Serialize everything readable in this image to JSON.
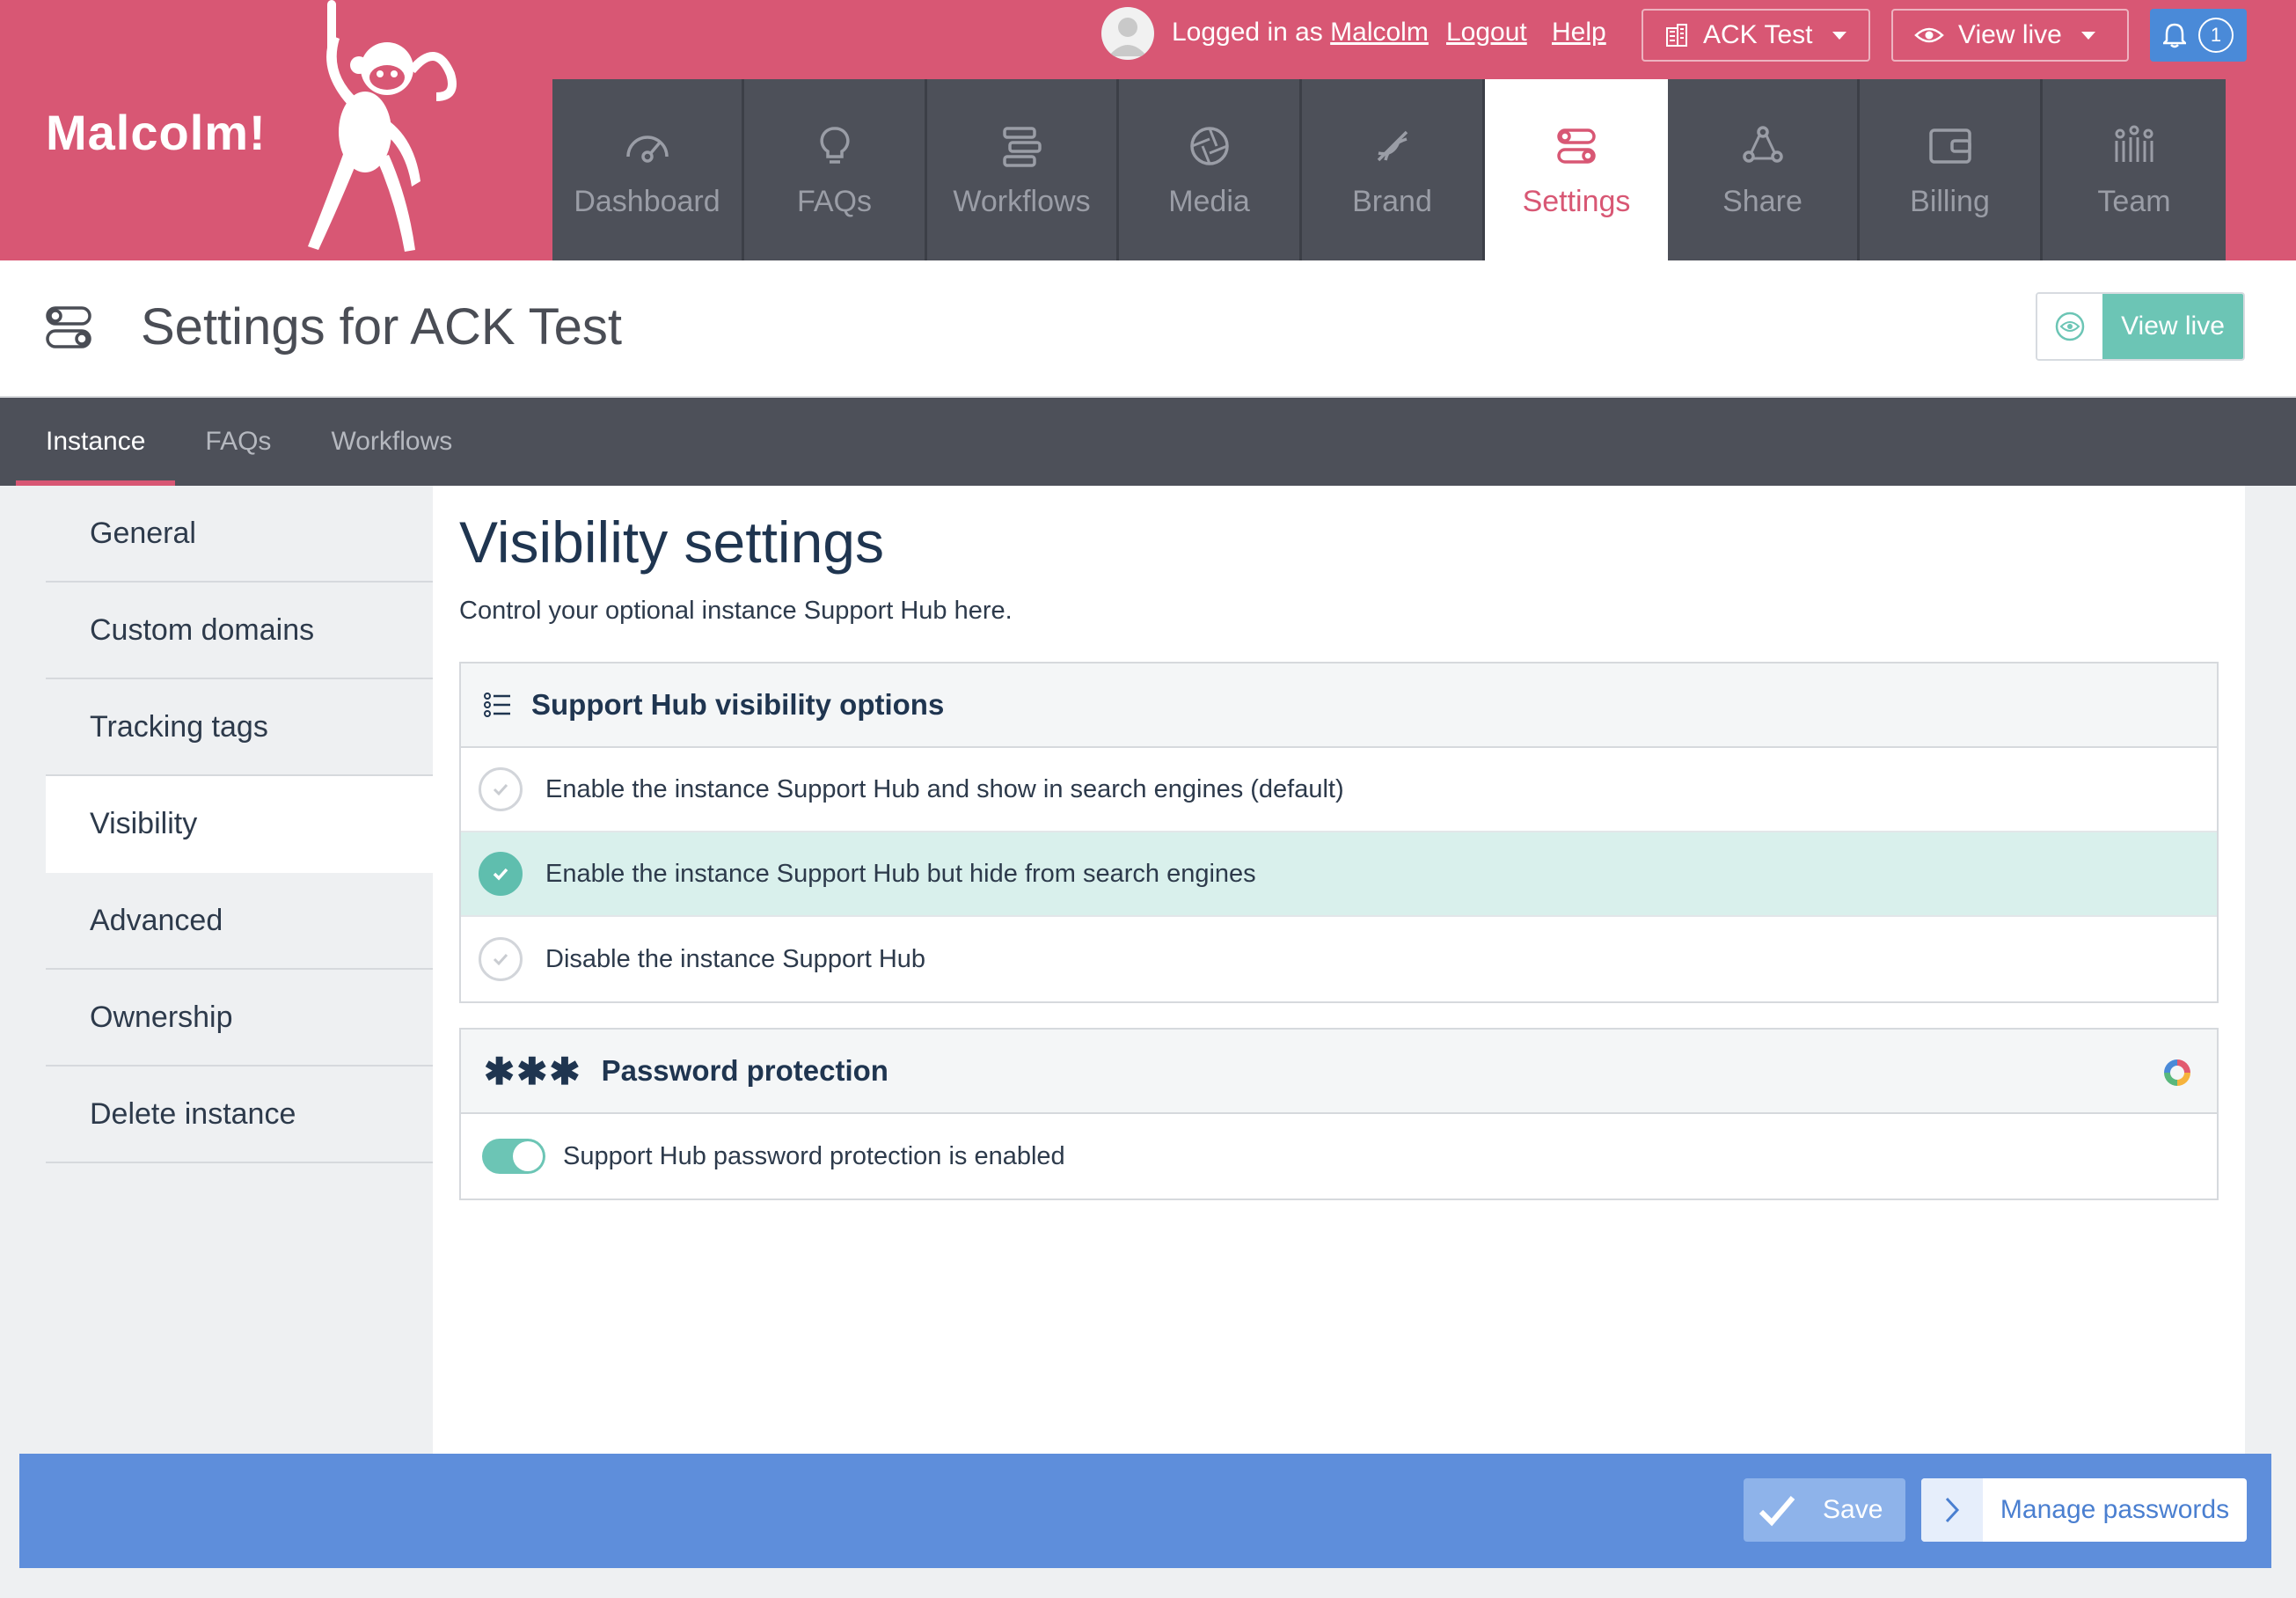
{
  "brand": {
    "name": "Malcolm!"
  },
  "topbar": {
    "logged_in_prefix": "Logged in as",
    "username": "Malcolm",
    "logout": "Logout",
    "help": "Help",
    "instance_label": "ACK Test",
    "view_live_label": "View live",
    "notification_count": "1"
  },
  "nav": [
    {
      "label": "Dashboard",
      "icon": "dashboard-icon"
    },
    {
      "label": "FAQs",
      "icon": "lightbulb-icon"
    },
    {
      "label": "Workflows",
      "icon": "workflows-icon"
    },
    {
      "label": "Media",
      "icon": "aperture-icon"
    },
    {
      "label": "Brand",
      "icon": "dna-icon"
    },
    {
      "label": "Settings",
      "icon": "settings-icon",
      "active": true
    },
    {
      "label": "Share",
      "icon": "share-icon"
    },
    {
      "label": "Billing",
      "icon": "wallet-icon"
    },
    {
      "label": "Team",
      "icon": "team-icon"
    }
  ],
  "page": {
    "title": "Settings for ACK Test",
    "view_live_label": "View live"
  },
  "subtabs": [
    {
      "label": "Instance",
      "active": true
    },
    {
      "label": "FAQs"
    },
    {
      "label": "Workflows"
    }
  ],
  "sidemenu": [
    {
      "label": "General"
    },
    {
      "label": "Custom domains"
    },
    {
      "label": "Tracking tags"
    },
    {
      "label": "Visibility",
      "active": true
    },
    {
      "label": "Advanced"
    },
    {
      "label": "Ownership"
    },
    {
      "label": "Delete instance"
    }
  ],
  "content": {
    "title": "Visibility settings",
    "description": "Control your optional instance Support Hub here.",
    "visibility_panel": {
      "heading": "Support Hub visibility options",
      "options": [
        {
          "label": "Enable the instance Support Hub and show in search engines (default)",
          "selected": false
        },
        {
          "label": "Enable the instance Support Hub but hide from search engines",
          "selected": true
        },
        {
          "label": "Disable the instance Support Hub",
          "selected": false
        }
      ]
    },
    "password_panel": {
      "asterisks": "✱✱✱",
      "heading": "Password protection",
      "toggle_label": "Support Hub password protection is enabled",
      "toggle_on": true
    }
  },
  "actions": {
    "save_label": "Save",
    "manage_passwords_label": "Manage passwords"
  },
  "colors": {
    "brand_pink": "#d85774",
    "nav_dark": "#4d5059",
    "accent_teal": "#6cc5b5",
    "action_blue": "#5e8edb"
  }
}
